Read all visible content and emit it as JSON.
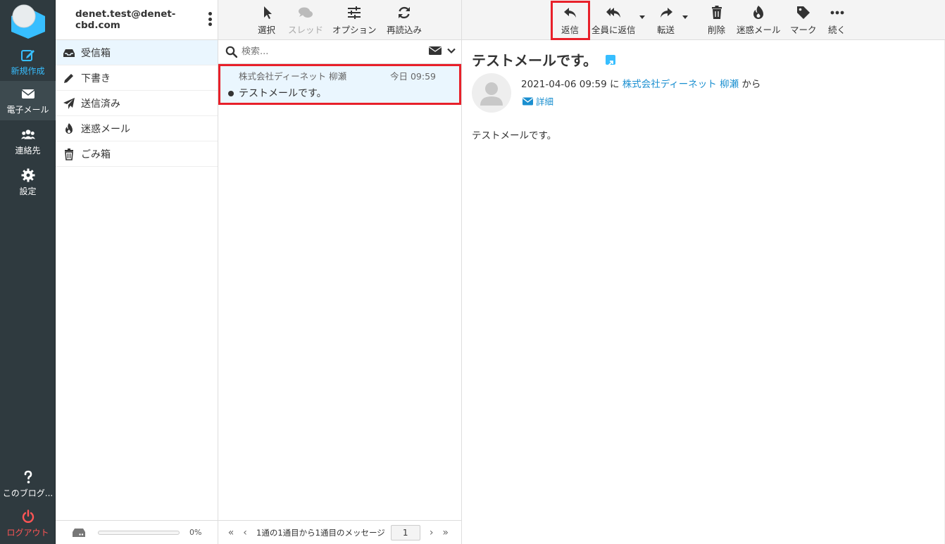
{
  "rail": {
    "compose": "新規作成",
    "mail": "電子メール",
    "contacts": "連絡先",
    "settings": "設定",
    "about": "このブログ...",
    "logout": "ログアウト"
  },
  "account": "denet.test@denet-cbd.com",
  "folders": [
    {
      "label": "受信箱",
      "icon": "inbox-icon"
    },
    {
      "label": "下書き",
      "icon": "pencil-icon"
    },
    {
      "label": "送信済み",
      "icon": "paper-plane-icon"
    },
    {
      "label": "迷惑メール",
      "icon": "fire-icon"
    },
    {
      "label": "ごみ箱",
      "icon": "trash-icon"
    }
  ],
  "quota": {
    "percent_label": "0%",
    "fraction": 0.0
  },
  "list_toolbar": {
    "select": "選択",
    "thread": "スレッド",
    "options": "オプション",
    "refresh": "再読込み"
  },
  "search": {
    "placeholder": "検索..."
  },
  "messages": [
    {
      "from": "株式会社ディーネット 柳瀬",
      "date": "今日 09:59",
      "subject": "テストメールです。",
      "unread": true
    }
  ],
  "pager": {
    "text": "1通の1通目から1通目のメッセージ",
    "page": "1"
  },
  "message_toolbar": {
    "reply": "返信",
    "reply_all": "全員に返信",
    "forward": "転送",
    "delete": "削除",
    "junk": "迷惑メール",
    "mark": "マーク",
    "more": "続く"
  },
  "message": {
    "subject": "テストメールです。",
    "date": "2021-04-06 09:59",
    "date_suffix": " に ",
    "from": "株式会社ディーネット 柳瀬",
    "from_suffix": " から",
    "details": "詳細",
    "body": "テストメールです。"
  },
  "colors": {
    "accent": "#37beff",
    "highlight": "#e8202a",
    "rail": "#2f3a3f",
    "selected": "#eaf6fe"
  }
}
